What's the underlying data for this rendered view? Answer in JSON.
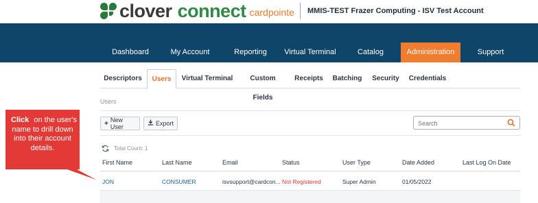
{
  "header": {
    "logo": {
      "word1": "clover",
      "word2": "connect",
      "word3": "cardpointe"
    },
    "account": "MMIS-TEST Frazer Computing - ISV Test Account"
  },
  "nav": {
    "items": [
      {
        "label": "Dashboard"
      },
      {
        "label": "My Account"
      },
      {
        "label": "Reporting"
      },
      {
        "label": "Virtual Terminal"
      },
      {
        "label": "Catalog"
      },
      {
        "label": "Administration"
      },
      {
        "label": "Support"
      }
    ],
    "active": "Administration"
  },
  "subtabs": {
    "items": [
      {
        "label": "Descriptors"
      },
      {
        "label": "Users"
      },
      {
        "label": "Virtual Terminal"
      },
      {
        "label": "Custom Fields"
      },
      {
        "label": "Receipts"
      },
      {
        "label": "Batching"
      },
      {
        "label": "Security"
      },
      {
        "label": "Credentials"
      }
    ],
    "active": "Users"
  },
  "users": {
    "section_label": "Users",
    "new_user_label": "New User",
    "export_label": "Export",
    "search_placeholder": "Search",
    "total_count": "Total Count: 1",
    "columns": [
      "First Name",
      "Last Name",
      "Email",
      "Status",
      "User Type",
      "Date Added",
      "Last Log On Date"
    ],
    "rows": [
      {
        "first_name": "JON",
        "last_name": "CONSUMER",
        "email": "isvsupport@cardcon...",
        "status": "Not Registered",
        "user_type": "Super Admin",
        "date_added": "01/05/2022",
        "last_log_on": ""
      }
    ]
  },
  "callout": {
    "click": "Click",
    "text": "on the user's name to drill down into their account details."
  },
  "colors": {
    "nav_bg": "#0f4568",
    "active_orange": "#f07c2e",
    "callout_red": "#e43a37",
    "brand_green": "#2f8a46",
    "link_blue": "#1b5f96",
    "status_red": "#e03a2c"
  }
}
